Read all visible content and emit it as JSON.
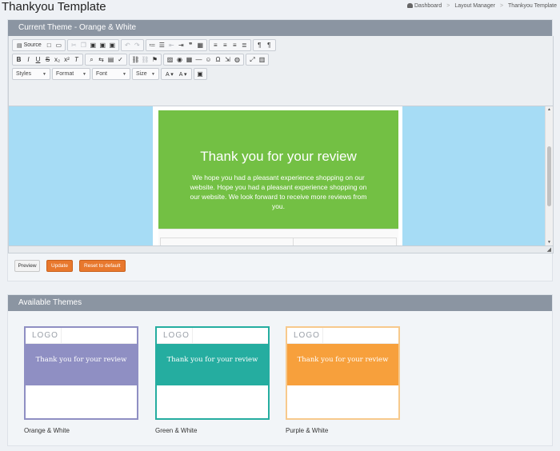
{
  "page": {
    "title": "Thankyou Template"
  },
  "breadcrumb": {
    "home": "Dashboard",
    "item2": "Layout Manager",
    "item3": "Thankyou Template"
  },
  "editor": {
    "heading": "Current Theme - Orange & White",
    "toolbar": {
      "source_label": "Source",
      "styles": "Styles",
      "format": "Format",
      "font": "Font",
      "size": "Size"
    },
    "content": {
      "title": "Thank you for your review",
      "message": "We hope you had a pleasant experience shopping on our website. Hope you had a pleasant experience shopping on our website. We look forward to receive more reviews from you."
    },
    "hero_color": "#73c044",
    "canvas_color": "#a6dcf5"
  },
  "actions": {
    "preview": "Preview",
    "update": "Update",
    "reset": "Reset to default"
  },
  "themes": {
    "heading": "Available Themes",
    "items": [
      {
        "name": "Orange & White",
        "color": "#8f8fc3",
        "border": "#8f8fc3",
        "logo": "LOGO",
        "title": "Thank you for your review"
      },
      {
        "name": "Green & White",
        "color": "#25ada0",
        "border": "#25ada0",
        "logo": "LOGO",
        "title": "Thank you for your review"
      },
      {
        "name": "Purple & White",
        "color": "#f7a03c",
        "border": "#f7c98c",
        "logo": "LOGO",
        "title": "Thank you for your review"
      }
    ]
  }
}
